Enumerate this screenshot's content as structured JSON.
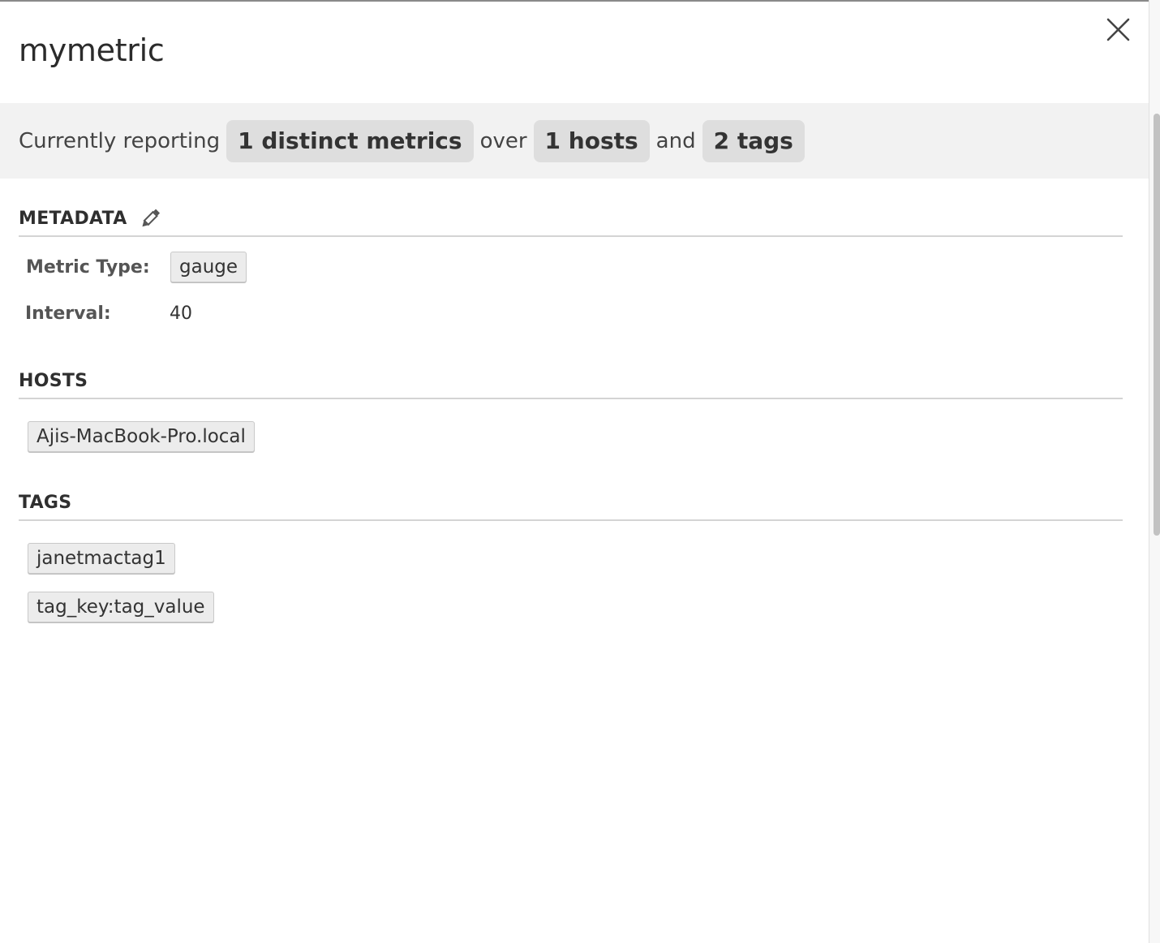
{
  "panel": {
    "title": "mymetric",
    "close_icon": "close-icon"
  },
  "summary": {
    "prefix": "Currently reporting",
    "metrics": "1 distinct metrics",
    "over": "over",
    "hosts": "1 hosts",
    "and": "and",
    "tags": "2 tags"
  },
  "metadata": {
    "title": "METADATA",
    "edit_icon": "pencil-icon",
    "metric_type_label": "Metric Type:",
    "metric_type_value": "gauge",
    "interval_label": "Interval:",
    "interval_value": "40"
  },
  "hosts": {
    "title": "HOSTS",
    "items": [
      "Ajis-MacBook-Pro.local"
    ]
  },
  "tags": {
    "title": "TAGS",
    "items": [
      "janetmactag1",
      "tag_key:tag_value"
    ]
  },
  "colors": {
    "summary_bg": "#f2f2f2",
    "pill_bg": "#dedede",
    "chip_bg": "#ececec"
  }
}
